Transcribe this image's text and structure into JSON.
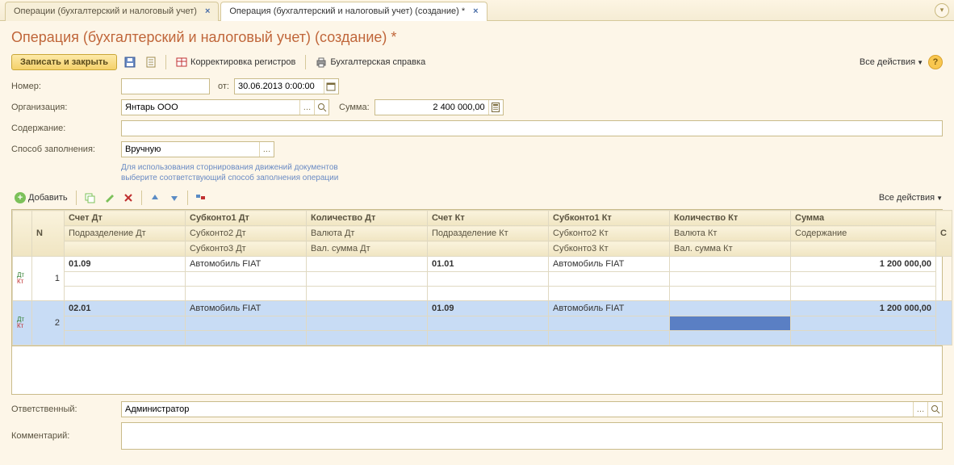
{
  "tabs": [
    {
      "label": "Операции (бухгалтерский и налоговый учет)"
    },
    {
      "label": "Операция (бухгалтерский и налоговый учет) (создание) *"
    }
  ],
  "page_title": "Операция (бухгалтерский и налоговый учет) (создание) *",
  "toolbar": {
    "save_close": "Записать и закрыть",
    "correct_registers": "Корректировка регистров",
    "accounting_ref": "Бухгалтерская справка",
    "all_actions": "Все действия"
  },
  "form": {
    "number_label": "Номер:",
    "number_value": "",
    "from_label": "от:",
    "date_value": "30.06.2013 0:00:00",
    "org_label": "Организация:",
    "org_value": "Янтарь ООО",
    "sum_label": "Сумма:",
    "sum_value": "2 400 000,00",
    "content_label": "Содержание:",
    "content_value": "",
    "fill_method_label": "Способ заполнения:",
    "fill_method_value": "Вручную",
    "hint_line1": "Для использования сторнирования движений документов",
    "hint_line2": "выберите соответствующий способ заполнения операции"
  },
  "grid_toolbar": {
    "add": "Добавить",
    "all_actions": "Все действия"
  },
  "grid": {
    "headers": {
      "n": "N",
      "acc_dt": "Счет Дт",
      "subc1_dt": "Субконто1 Дт",
      "qty_dt": "Количество Дт",
      "acc_kt": "Счет Кт",
      "subc1_kt": "Субконто1 Кт",
      "qty_kt": "Количество Кт",
      "sum": "Сумма",
      "s_col": "С",
      "dept_dt": "Подразделение Дт",
      "subc2_dt": "Субконто2 Дт",
      "cur_dt": "Валюта Дт",
      "dept_kt": "Подразделение Кт",
      "subc2_kt": "Субконто2 Кт",
      "cur_kt": "Валюта Кт",
      "content": "Содержание",
      "subc3_dt": "Субконто3 Дт",
      "valsum_dt": "Вал. сумма Дт",
      "subc3_kt": "Субконто3 Кт",
      "valsum_kt": "Вал. сумма Кт"
    },
    "rows": [
      {
        "n": "1",
        "acc_dt": "01.09",
        "subc1_dt": "Автомобиль FIAT",
        "acc_kt": "01.01",
        "subc1_kt": "Автомобиль FIAT",
        "sum": "1 200 000,00"
      },
      {
        "n": "2",
        "acc_dt": "02.01",
        "subc1_dt": "Автомобиль FIAT",
        "acc_kt": "01.09",
        "subc1_kt": "Автомобиль FIAT",
        "sum": "1 200 000,00"
      }
    ]
  },
  "footer": {
    "responsible_label": "Ответственный:",
    "responsible_value": "Администратор",
    "comment_label": "Комментарий:",
    "comment_value": ""
  }
}
